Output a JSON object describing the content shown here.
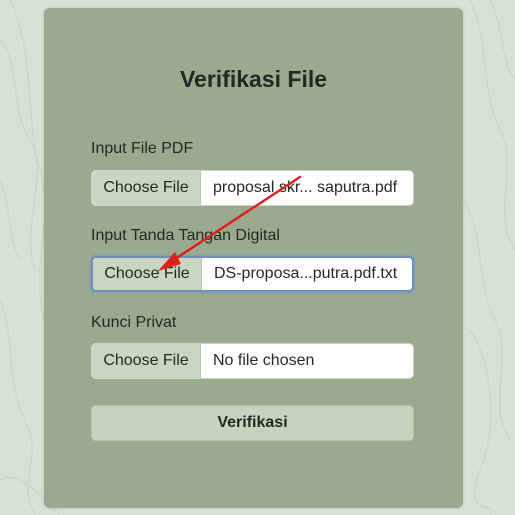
{
  "form": {
    "title": "Verifikasi File",
    "fields": [
      {
        "label": "Input File PDF",
        "button_label": "Choose File",
        "file_name": "proposal skr... saputra.pdf"
      },
      {
        "label": "Input Tanda Tangan Digital",
        "button_label": "Choose File",
        "file_name": "DS-proposa...putra.pdf.txt"
      },
      {
        "label": "Kunci Privat",
        "button_label": "Choose File",
        "file_name": "No file chosen"
      }
    ],
    "submit_label": "Verifikasi"
  },
  "colors": {
    "page_background": "#d5e2d6",
    "card_background": "#99aa8f",
    "button_background": "#c9d6c1",
    "focus_ring": "#6f8fb8",
    "annotation_arrow": "#e0201b"
  }
}
